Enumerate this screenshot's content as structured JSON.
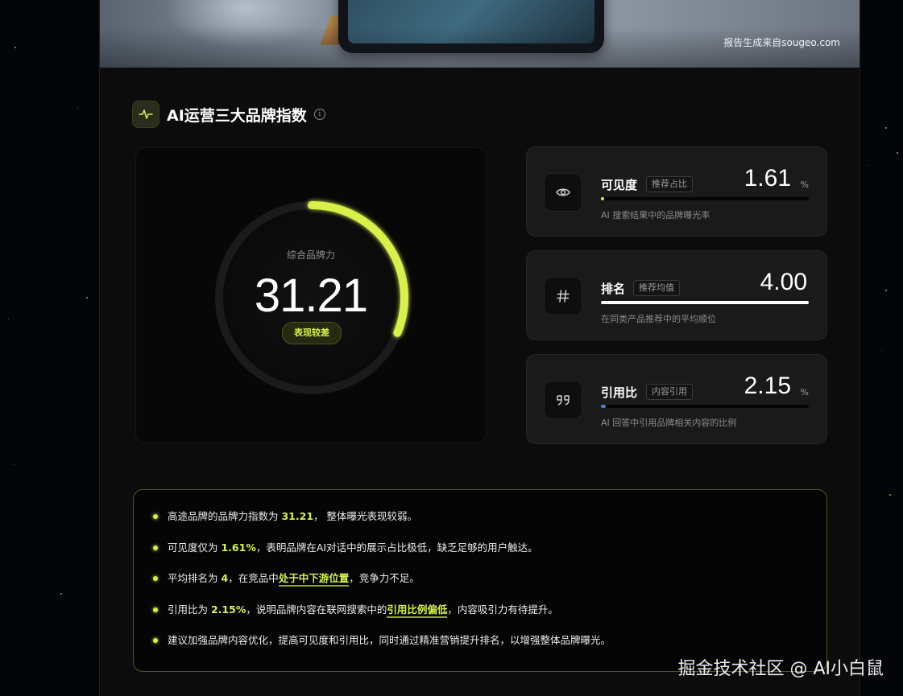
{
  "hero": {
    "credit": "报告生成来自sougeo.com"
  },
  "section": {
    "title": "AI运营三大品牌指数",
    "icon": "pulse-icon",
    "info_icon": "info-icon"
  },
  "gauge": {
    "label": "综合品牌力",
    "value": "31.21",
    "percent": 31.21,
    "badge": "表现较差",
    "accent": "#d8f04a"
  },
  "metrics": [
    {
      "name": "可见度",
      "tag": "推荐占比",
      "value": "1.61",
      "unit": "%",
      "level": 0.0161,
      "desc": "AI 搜索结果中的品牌曝光率",
      "icon": "eye-icon",
      "bar_color": "#d8f04a"
    },
    {
      "name": "排名",
      "tag": "推荐均值",
      "value": "4.00",
      "unit": "",
      "level": 1.0,
      "desc": "在同类产品推荐中的平均顺位",
      "icon": "hash-icon",
      "bar_color": "#ffffff"
    },
    {
      "name": "引用比",
      "tag": "内容引用",
      "value": "2.15",
      "unit": "%",
      "level": 0.0215,
      "desc": "AI 回答中引用品牌相关内容的比例",
      "icon": "quote-icon",
      "bar_color": "#4a7bd8"
    }
  ],
  "summary": [
    {
      "pre": "高途品牌的品牌力指数为 ",
      "hl": "31.21",
      "mid": "， 整体曝光表现较弱。",
      "ul": "",
      "post": ""
    },
    {
      "pre": "可见度仅为 ",
      "hl": "1.61%",
      "mid": "，表明品牌在AI对话中的展示占比极低，缺乏足够的用户触达。",
      "ul": "",
      "post": ""
    },
    {
      "pre": "平均排名为 ",
      "hl": "4",
      "mid": "，在竞品中",
      "ul": "处于中下游位置",
      "post": "，竞争力不足。"
    },
    {
      "pre": "引用比为 ",
      "hl": "2.15%",
      "mid": "，说明品牌内容在联网搜索中的",
      "ul": "引用比例偏低",
      "post": "，内容吸引力有待提升。"
    },
    {
      "pre": "建议加强品牌内容优化，提高可见度和引用比，同时通过精准营销提升排名，以增强整体品牌曝光。",
      "hl": "",
      "mid": "",
      "ul": "",
      "post": ""
    }
  ],
  "watermark": "掘金技术社区 @ AI小白鼠"
}
